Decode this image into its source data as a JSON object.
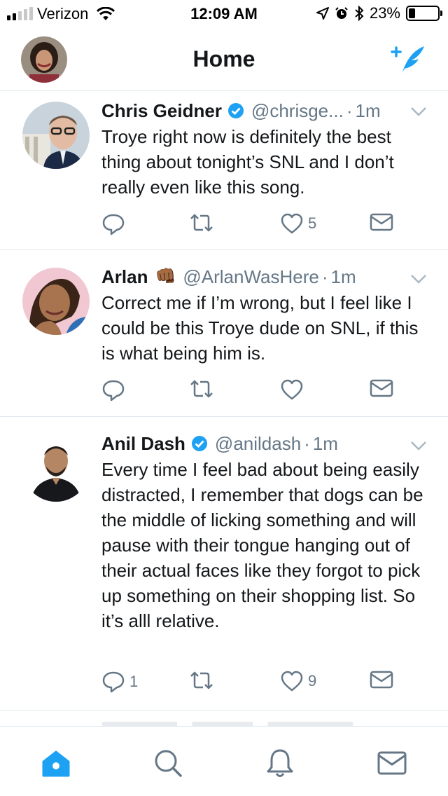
{
  "status_bar": {
    "carrier": "Verizon",
    "time": "12:09 AM",
    "battery": "23%",
    "battery_level": 0.23
  },
  "header": {
    "title": "Home"
  },
  "tweets": [
    {
      "name": "Chris Geidner",
      "verified": true,
      "handle": "@chrisge...",
      "time": "1m",
      "text": "Troye right now is definitely the best thing about tonight’s SNL and I don’t really even like this song.",
      "replies": "",
      "likes": "5"
    },
    {
      "name": "Arlan",
      "emoji": "👊🏾",
      "verified": false,
      "handle": "@ArlanWasHere",
      "time": "1m",
      "text": "Correct me if I’m wrong, but I feel like I could be this Troye dude on SNL, if this is what being him is.",
      "replies": "",
      "likes": ""
    },
    {
      "name": "Anil Dash",
      "verified": true,
      "handle": "@anildash",
      "time": "1m",
      "text": "Every time I feel bad about being easily distracted, I remember that dogs can be the middle of licking something and will pause with their tongue hanging out of their actual faces like they forgot to pick up something on their shopping list. So it’s alll relative.",
      "replies": "1",
      "likes": "9"
    }
  ],
  "colors": {
    "accent": "#1da1f2",
    "muted": "#657786",
    "text": "#14171a",
    "divider": "#e1e8ed"
  },
  "icons": [
    "compose-icon",
    "reply-icon",
    "retweet-icon",
    "like-icon",
    "dm-icon",
    "home-icon",
    "search-icon",
    "notifications-icon",
    "messages-icon"
  ]
}
